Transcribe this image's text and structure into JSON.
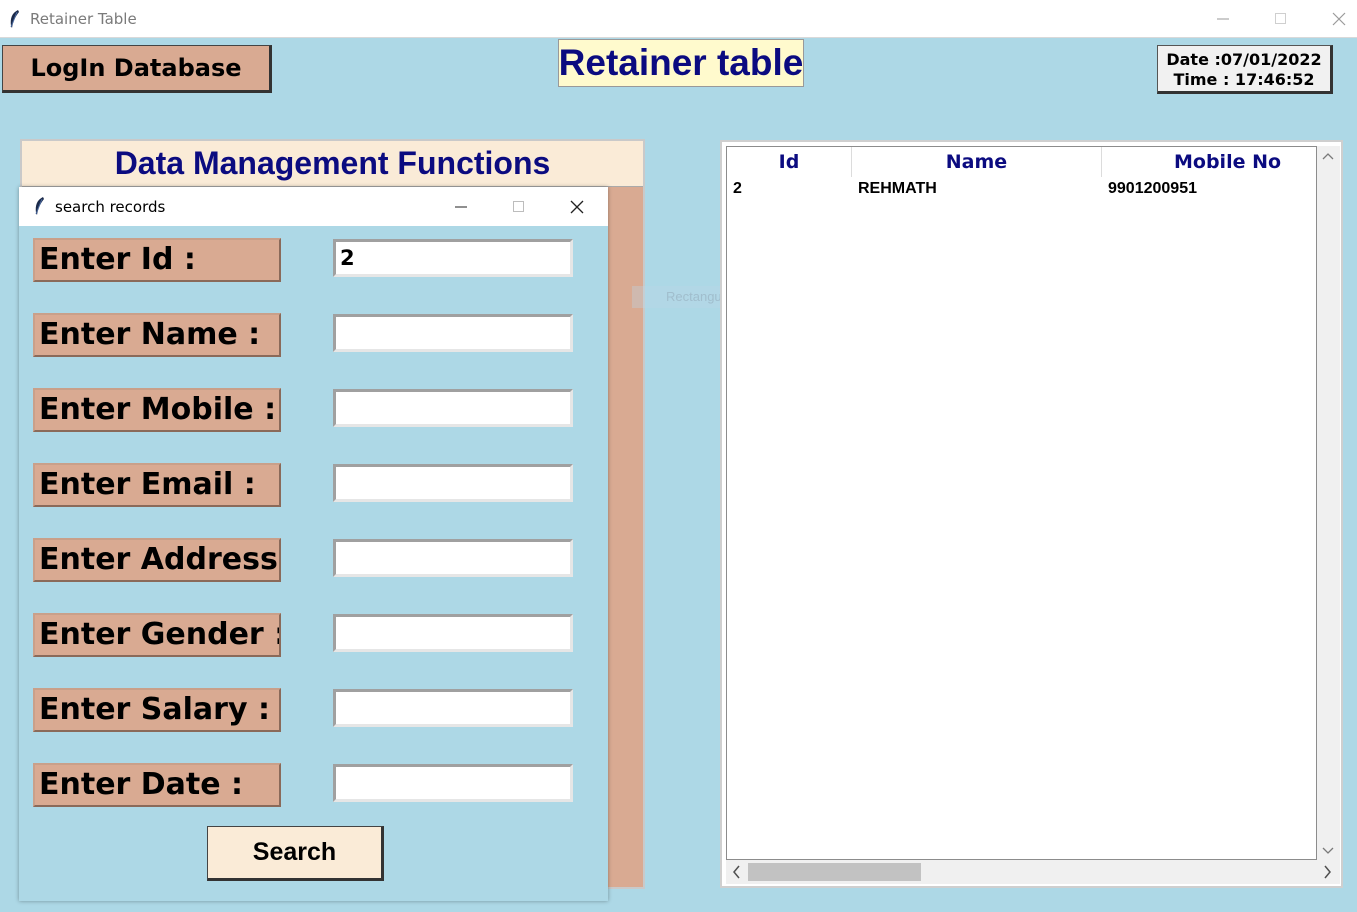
{
  "window": {
    "title": "Retainer Table"
  },
  "header": {
    "login_button": "LogIn Database",
    "app_title": "Retainer table",
    "date_text": "Date :07/01/2022",
    "time_text": "Time : 17:46:52"
  },
  "data_management": {
    "title": "Data Management Functions"
  },
  "dialog": {
    "title": "search records",
    "fields": [
      {
        "label": "Enter Id :",
        "value": "2"
      },
      {
        "label": "Enter Name :",
        "value": ""
      },
      {
        "label": "Enter Mobile :",
        "value": ""
      },
      {
        "label": "Enter Email :",
        "value": ""
      },
      {
        "label": "Enter Address:",
        "value": ""
      },
      {
        "label": "Enter Gender :",
        "value": ""
      },
      {
        "label": "Enter Salary :",
        "value": ""
      },
      {
        "label": "Enter Date :",
        "value": ""
      }
    ],
    "search_button": "Search"
  },
  "overlay": {
    "ghost_text": "Rectangular Snip"
  },
  "table": {
    "columns": [
      "Id",
      "Name",
      "Mobile No"
    ],
    "rows": [
      [
        "2",
        "REHMATH",
        "9901200951"
      ]
    ]
  },
  "colors": {
    "background": "#add8e6",
    "label_bg": "#d9aa92",
    "header_bg": "#faebd7",
    "title_bg": "#fffacd",
    "heading_text": "#0b0b80"
  }
}
